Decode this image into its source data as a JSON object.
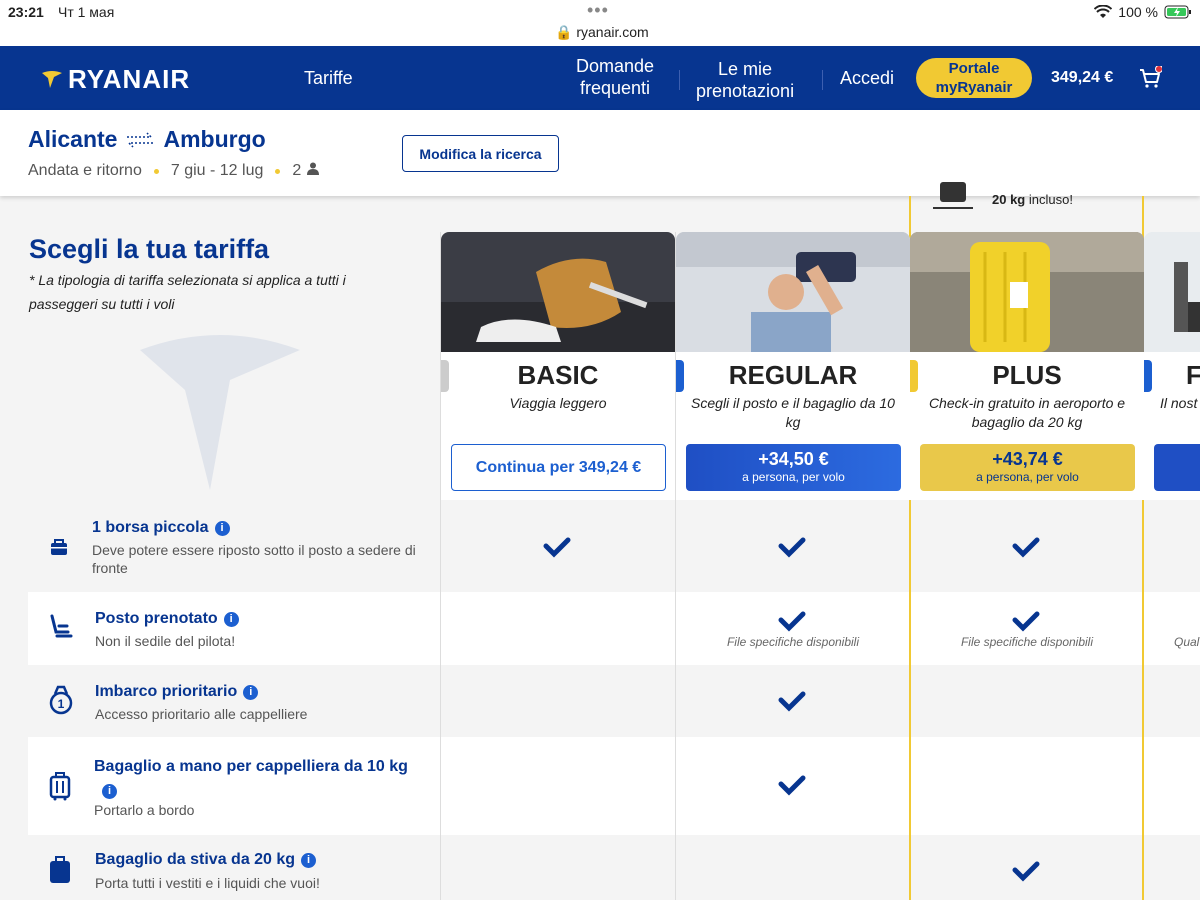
{
  "status": {
    "time": "23:21",
    "date": "Чт 1 мая",
    "url": "ryanair.com",
    "battery": "100 %"
  },
  "nav": {
    "brand": "RYANAIR",
    "tariffe": "Tariffe",
    "faq_line1": "Domande",
    "faq_line2": "frequenti",
    "bookings_line1": "Le mie",
    "bookings_line2": "prenotazioni",
    "login": "Accedi",
    "portal_line1": "Portale",
    "portal_line2": "myRyanair",
    "price": "349,24 €"
  },
  "search": {
    "from": "Alicante",
    "to": "Amburgo",
    "trip_type": "Andata e ritorno",
    "dates": "7 giu - 12 lug",
    "passengers": "2",
    "modify": "Modifica la ricerca"
  },
  "page": {
    "title": "Scegli la tua tariffa",
    "subtitle": "* La tipologia di tariffa selezionata si applica a tutti i passeggeri su tutti i voli",
    "peek_bold": "20 kg",
    "peek_rest": " incluso!"
  },
  "fares": [
    {
      "name": "BASIC",
      "sub": "Viaggia leggero",
      "btn": "Continua per 349,24 €"
    },
    {
      "name": "REGULAR",
      "sub": "Scegli il posto e il bagaglio da 10 kg",
      "price": "+34,50 €",
      "per": "a persona, per volo"
    },
    {
      "name": "PLUS",
      "sub": "Check-in gratuito in aeroporto e bagaglio da 20 kg",
      "price": "+43,74 €",
      "per": "a persona, per volo"
    },
    {
      "name": "F",
      "sub": "Il nost",
      "note": "Qual"
    }
  ],
  "features": [
    {
      "title": "1 borsa piccola",
      "desc": "Deve potere essere riposto sotto il posto a sedere di fronte"
    },
    {
      "title": "Posto prenotato",
      "desc": "Non il sedile del pilota!"
    },
    {
      "title": "Imbarco prioritario",
      "desc": "Accesso prioritario alle cappelliere"
    },
    {
      "title": "Bagaglio a mano per cappelliera da 10 kg",
      "desc": "Portarlo a bordo"
    },
    {
      "title": "Bagaglio da stiva da 20 kg",
      "desc": "Porta tutti i vestiti e i liquidi che vuoi!"
    }
  ],
  "seat_note": "File specifiche disponibili",
  "colors": {
    "navy": "#073590",
    "yellow": "#f1c933",
    "blue": "#1c5fd0"
  }
}
